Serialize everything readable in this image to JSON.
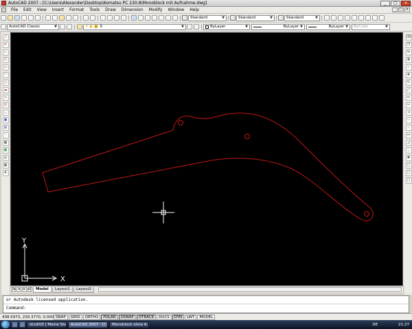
{
  "window": {
    "title": "AutoCAD 2007 - [C:\\Users\\Alexander\\Desktop\\Komatsu PC 130-8\\Monoblock mit Aufnahme.dwg]",
    "buttons": [
      "_",
      "□",
      "×"
    ]
  },
  "menu": {
    "items": [
      "File",
      "Edit",
      "View",
      "Insert",
      "Format",
      "Tools",
      "Draw",
      "Dimension",
      "Modify",
      "Window",
      "Help"
    ]
  },
  "toolbar1": {
    "text_style": "Standard",
    "dim_style": "Standard",
    "table_style": "Standard"
  },
  "toolbar2": {
    "workspace": "AutoCAD Classic",
    "layer": "0",
    "color": "ByLayer",
    "linetype": "ByLayer",
    "lineweight": "ByLayer",
    "plotstyle": "ByColor"
  },
  "tabs": {
    "nav": [
      "|◂",
      "◂",
      "▸",
      "▸|"
    ],
    "items": [
      "Model",
      "Layout1",
      "Layout2"
    ]
  },
  "ucs": {
    "x_label": "X",
    "y_label": "Y"
  },
  "command": {
    "history": "or Autodesk licensed application.",
    "prompt": "Command:"
  },
  "status": {
    "coordinates": "438.5973, 239.3770, 0.0000",
    "toggles": [
      "SNAP",
      "GRID",
      "ORTHO",
      "POLAR",
      "OSNAP",
      "OTRACK",
      "DUCS",
      "DYN",
      "LWT",
      "MODEL"
    ]
  },
  "taskbar": {
    "tasks": [
      "studiVZ | Meine Star...",
      "AutoCAD 2007 - [C:...",
      "Monoblock ohne A..."
    ],
    "language": "DE",
    "clock": "21:27"
  },
  "colors": {
    "drawing_bg": "#000000",
    "geometry": "#c01818",
    "crosshair": "#ffffff"
  }
}
